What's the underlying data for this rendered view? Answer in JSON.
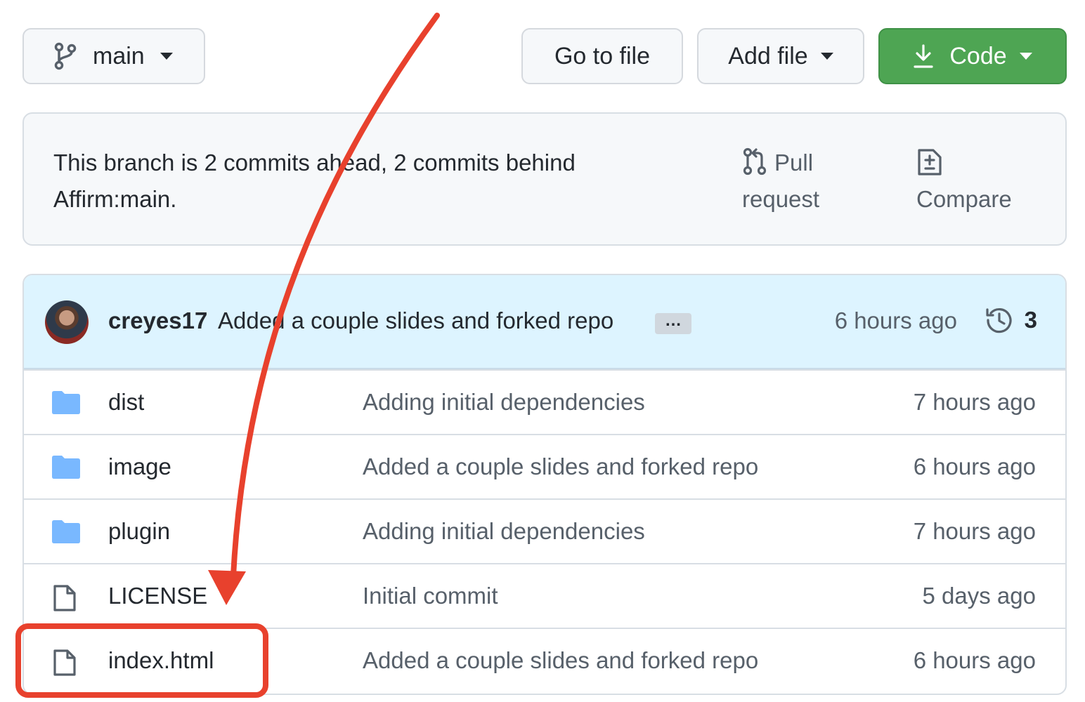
{
  "toolbar": {
    "branch_label": "main",
    "goto_label": "Go to file",
    "addfile_label": "Add file",
    "code_label": "Code"
  },
  "branch_status": {
    "message": "This branch is 2 commits ahead, 2 commits behind Affirm:main.",
    "pull_request_label": "Pull request",
    "compare_label": "Compare"
  },
  "latest_commit": {
    "author": "creyes17",
    "message": "Added a couple slides and forked repo",
    "ellipsis": "…",
    "time": "6 hours ago",
    "commit_count": "3"
  },
  "files": [
    {
      "type": "folder",
      "icon": "folder-icon",
      "name": "dist",
      "message": "Adding initial dependencies",
      "time": "7 hours ago"
    },
    {
      "type": "folder",
      "icon": "folder-icon",
      "name": "image",
      "message": "Added a couple slides and forked repo",
      "time": "6 hours ago"
    },
    {
      "type": "folder",
      "icon": "folder-icon",
      "name": "plugin",
      "message": "Adding initial dependencies",
      "time": "7 hours ago"
    },
    {
      "type": "file",
      "icon": "file-icon",
      "name": "LICENSE",
      "message": "Initial commit",
      "time": "5 days ago"
    },
    {
      "type": "file",
      "icon": "file-icon",
      "name": "index.html",
      "message": "Added a couple slides and forked repo",
      "time": "6 hours ago"
    }
  ],
  "colors": {
    "code_button": "#4ea553",
    "folder": "#79b8ff",
    "annotation": "#e8412d",
    "commit_bar": "#ddf4ff"
  }
}
